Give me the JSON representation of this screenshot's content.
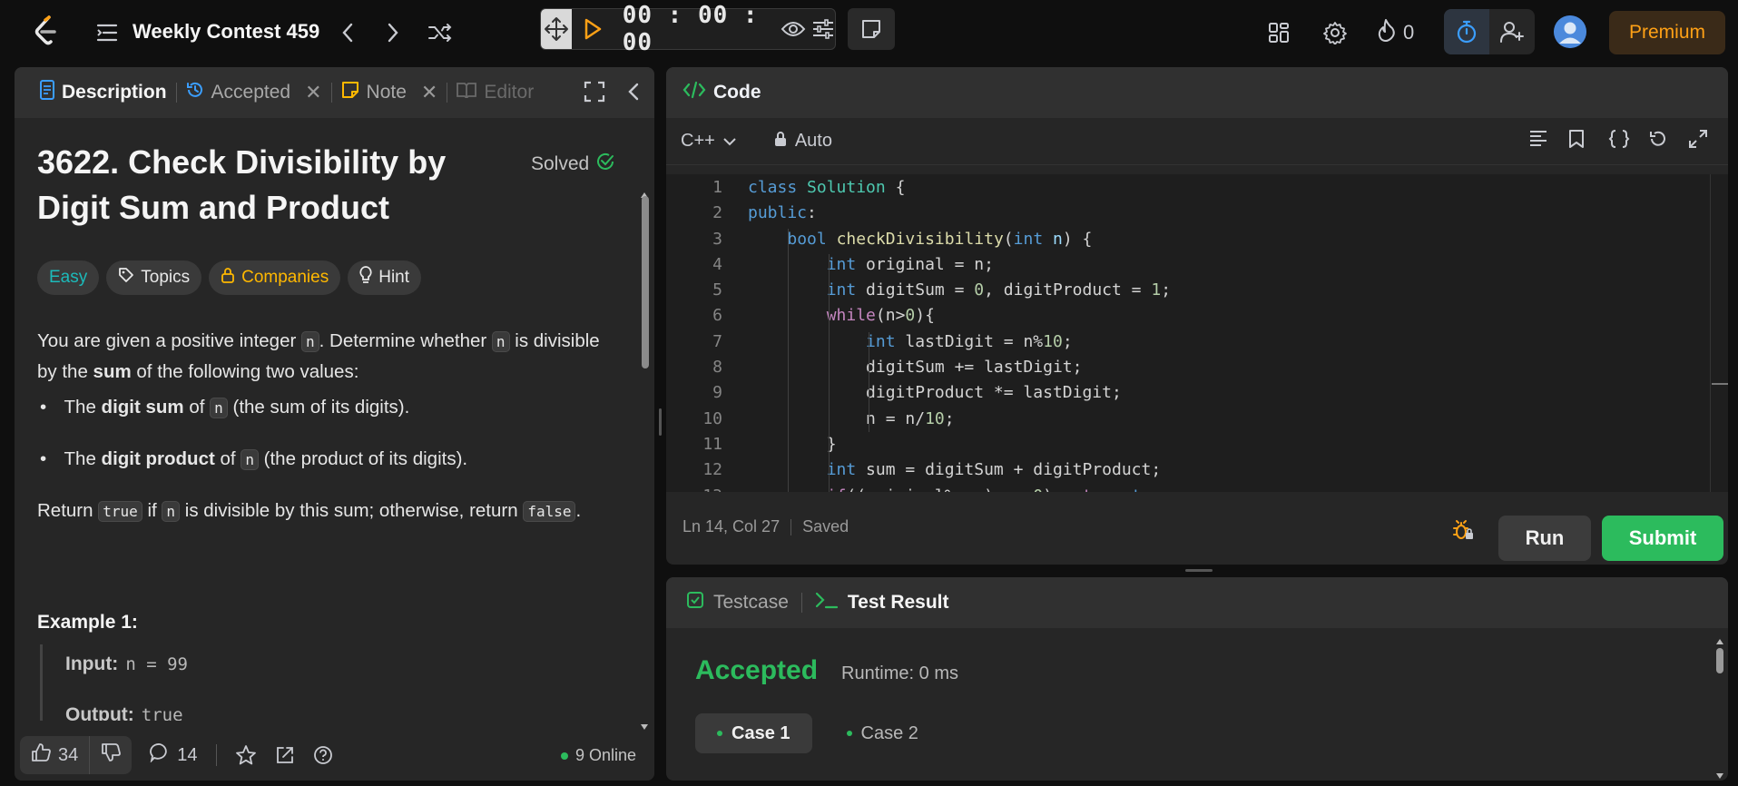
{
  "topbar": {
    "contest_title": "Weekly Contest 459",
    "timer": "00 : 00 : 00",
    "streak_count": "0",
    "premium_label": "Premium",
    "icons": [
      "leetcode-logo-icon",
      "problem-list-icon",
      "chevron-left-icon",
      "chevron-right-icon",
      "shuffle-icon",
      "drag-move-icon",
      "play-icon",
      "eye-icon",
      "sliders-icon",
      "note-icon",
      "grid-icon",
      "gear-icon",
      "fire-icon",
      "stopwatch-icon",
      "add-user-icon",
      "avatar"
    ]
  },
  "left_tabs": [
    {
      "label": "Description"
    },
    {
      "label": "Accepted"
    },
    {
      "label": "Note"
    },
    {
      "label": "Editor"
    }
  ],
  "problem": {
    "title": "3622. Check Divisibility by Digit Sum and Product",
    "status": "Solved",
    "tags": [
      "Easy",
      "Topics",
      "Companies",
      "Hint"
    ],
    "p1_a": "You are given a positive integer ",
    "p1_n1": "n",
    "p1_b": ". Determine whether ",
    "p1_n2": "n",
    "p1_c": " is divisible by the ",
    "p1_bold": "sum",
    "p1_d": " of the following two values:",
    "b1_a": "The ",
    "b1_bold": "digit sum",
    "b1_b": " of ",
    "b1_n": "n",
    "b1_c": " (the sum of its digits).",
    "b2_a": "The ",
    "b2_bold": "digit product",
    "b2_b": " of ",
    "b2_n": "n",
    "b2_c": " (the product of its digits).",
    "p2_a": "Return ",
    "p2_true": "true",
    "p2_b": " if ",
    "p2_n": "n",
    "p2_c": " is divisible by this sum; otherwise, return ",
    "p2_false": "false",
    "p2_d": ".",
    "example_title": "Example 1:",
    "ex_input_label": "Input:",
    "ex_input_value": "n = 99",
    "ex_output_label": "Output:",
    "ex_output_value": "true"
  },
  "bottom_bar": {
    "likes": "34",
    "comments": "14",
    "online": "9 Online"
  },
  "code_panel": {
    "title": "Code",
    "language": "C++",
    "mode": "Auto",
    "status_pos": "Ln 14, Col 27",
    "status_saved": "Saved",
    "run_label": "Run",
    "submit_label": "Submit",
    "line_numbers": [
      "1",
      "2",
      "3",
      "4",
      "5",
      "6",
      "7",
      "8",
      "9",
      "10",
      "11",
      "12",
      "13"
    ]
  },
  "test_panel": {
    "tab_testcase": "Testcase",
    "tab_result": "Test Result",
    "verdict": "Accepted",
    "runtime": "Runtime: 0 ms",
    "cases": [
      "Case 1",
      "Case 2"
    ]
  },
  "colors": {
    "accent_green": "#2cbb5d",
    "premium_orange": "#ffa116",
    "easy_teal": "#1cbaba",
    "companies_gold": "#ffb800"
  }
}
